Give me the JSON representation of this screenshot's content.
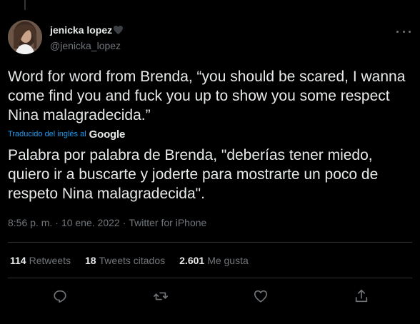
{
  "tweet": {
    "author": {
      "display_name": "jenicka lopez",
      "handle": "@jenicka_lopez"
    },
    "text": "Word for word from Brenda, “you should be scared, I wanna come find you and fuck you up to show you some respect Nina malagradecida.”",
    "translation": {
      "label": "Traducido del inglés al",
      "provider": "Google",
      "text": "Palabra por palabra de Brenda, \"deberías tener miedo, quiero ir a buscarte y joderte para mostrarte un poco de respeto Nina malagradecida\"."
    },
    "time": "8:56 p. m.",
    "separator": "·",
    "date": "10 ene. 2022",
    "source": "Twitter for iPhone",
    "stats": {
      "retweets_count": "114",
      "retweets_label": "Retweets",
      "quotes_count": "18",
      "quotes_label": "Tweets citados",
      "likes_count": "2.601",
      "likes_label": "Me gusta"
    },
    "actions": [
      "reply-icon",
      "retweet-icon",
      "like-icon",
      "share-icon"
    ]
  },
  "colors": {
    "background": "#000000",
    "text": "#e7e9ea",
    "secondary": "#71767b",
    "link": "#1d9bf0",
    "divider": "#2f3336"
  }
}
